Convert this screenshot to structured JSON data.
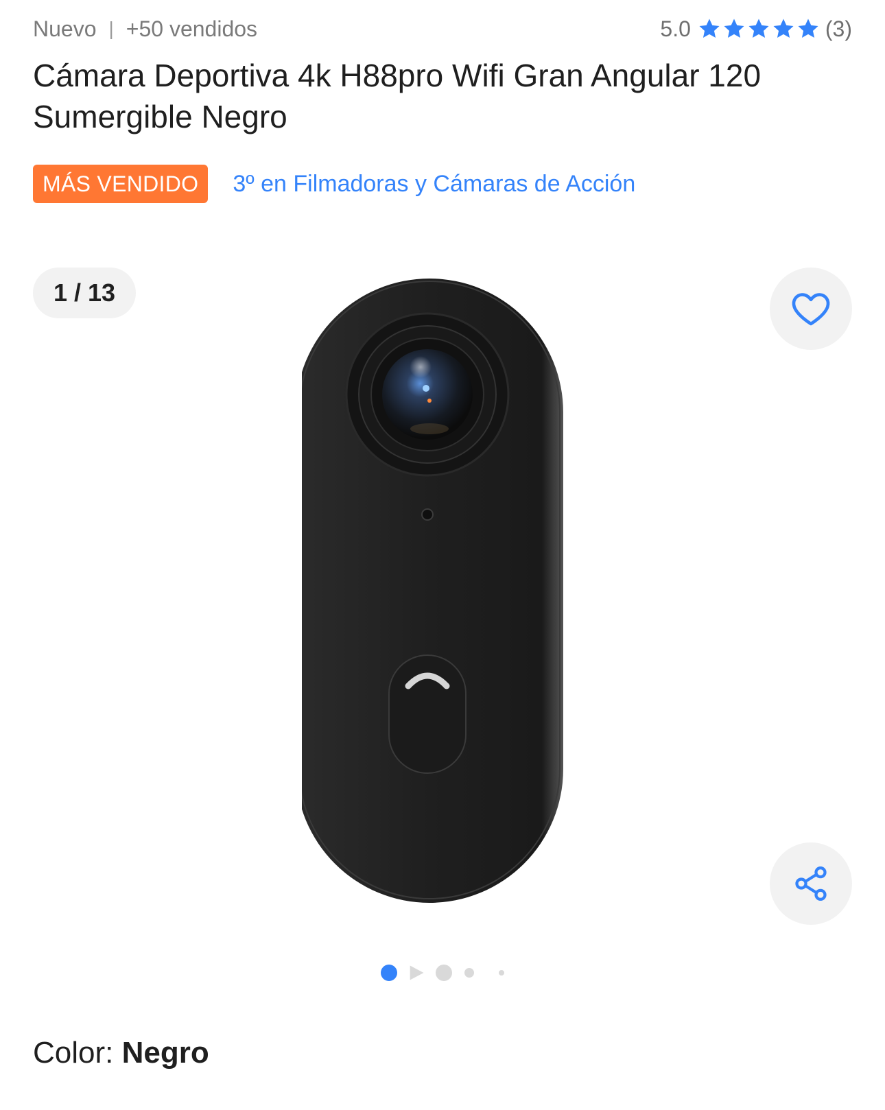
{
  "meta": {
    "condition": "Nuevo",
    "separator": "|",
    "sold": "+50 vendidos",
    "rating_score": "5.0",
    "rating_count": "(3)",
    "star_count": 5,
    "star_color": "#3483fa"
  },
  "title": "Cámara Deportiva 4k H88pro Wifi Gran Angular 120 Sumergible Negro",
  "badge": {
    "label": "MÁS VENDIDO",
    "color": "#ff7733"
  },
  "ranking": {
    "label": "3º en Filmadoras y Cámaras de Acción",
    "color": "#3483fa"
  },
  "gallery": {
    "counter": "1 / 13",
    "current_index": 1,
    "total": 13,
    "favorite_icon": "heart-outline-icon",
    "share_icon": "share-icon"
  },
  "variant": {
    "label": "Color: ",
    "value": "Negro"
  }
}
